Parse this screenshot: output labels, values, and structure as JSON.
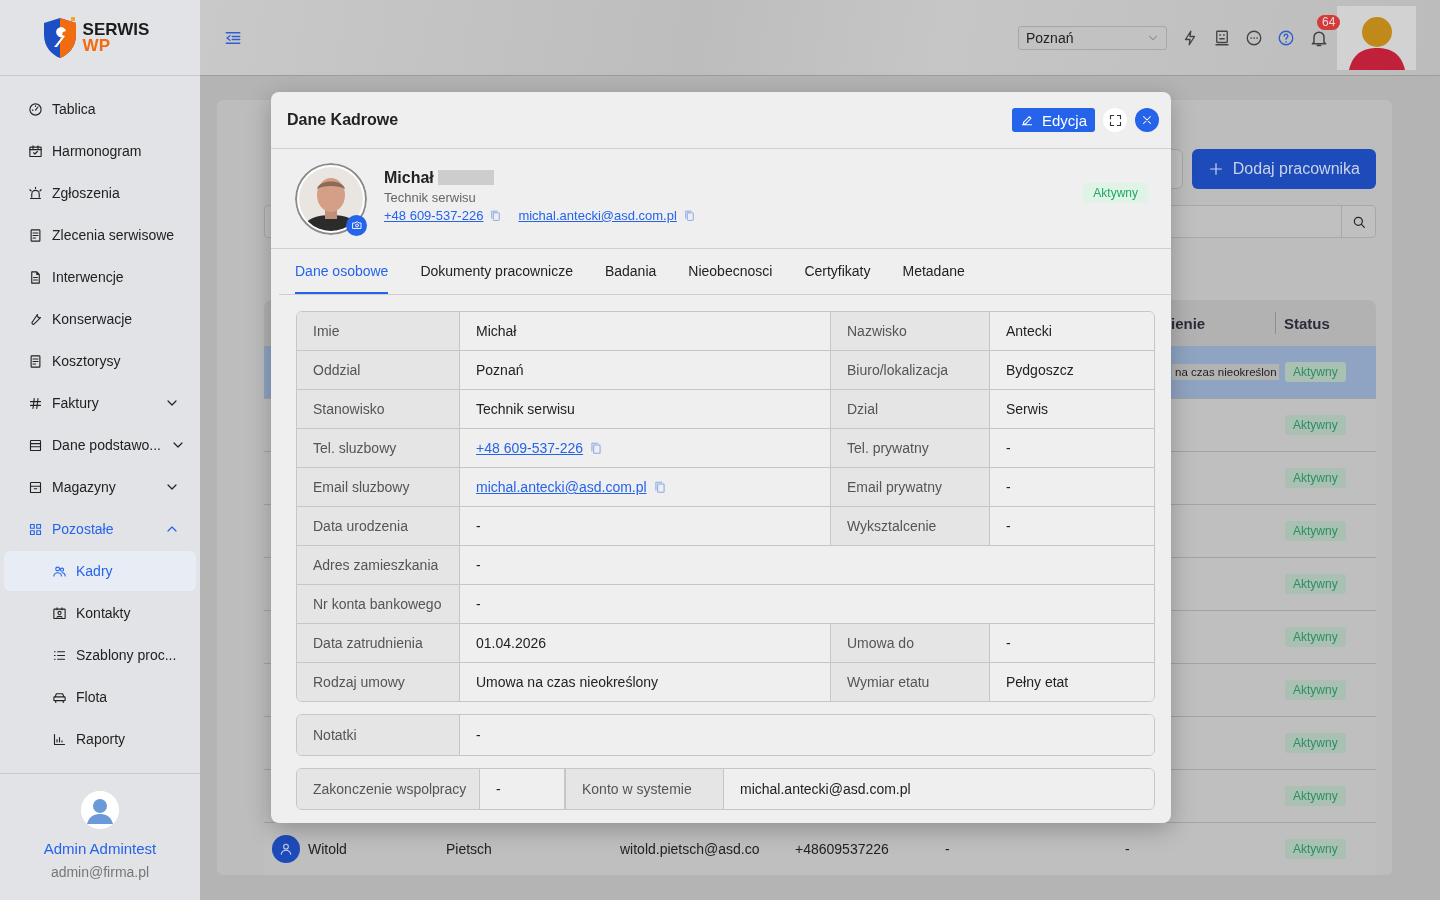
{
  "sidebar": {
    "logo": {
      "line_1": "SERWIS",
      "line_2": "WP"
    },
    "items": [
      {
        "label": "Tablica",
        "kind": "link",
        "selected": false
      },
      {
        "label": "Harmonogram",
        "kind": "link",
        "selected": false
      },
      {
        "label": "Zgłoszenia",
        "kind": "link",
        "selected": false
      },
      {
        "label": "Zlecenia serwisowe",
        "kind": "link",
        "selected": false
      },
      {
        "label": "Interwencje",
        "kind": "link",
        "selected": false
      },
      {
        "label": "Konserwacje",
        "kind": "link",
        "selected": false
      },
      {
        "label": "Kosztorysy",
        "kind": "link",
        "selected": false
      },
      {
        "label": "Faktury",
        "kind": "group",
        "expanded": false,
        "selected": false
      },
      {
        "label": "Dane podstawo...",
        "kind": "group",
        "expanded": false,
        "selected": false
      },
      {
        "label": "Magazyny",
        "kind": "group",
        "expanded": false,
        "selected": false
      },
      {
        "label": "Pozostałe",
        "kind": "group",
        "expanded": true,
        "selected": false,
        "children": [
          {
            "label": "Kadry",
            "selected": true
          },
          {
            "label": "Kontakty",
            "selected": false
          },
          {
            "label": "Szablony proc...",
            "selected": false
          },
          {
            "label": "Flota",
            "selected": false
          },
          {
            "label": "Raporty",
            "selected": false
          }
        ]
      }
    ],
    "user": {
      "name": "Admin Admintest",
      "email": "admin@firma.pl"
    }
  },
  "header": {
    "location_select": {
      "value": "Poznań"
    },
    "notifications": {
      "count": "64"
    }
  },
  "page": {
    "add_button": "Dodaj pracownika",
    "table": {
      "columns": [
        "ienie",
        "Status"
      ],
      "rows": [
        {
          "column_7": "na czas nieokreślon",
          "status": "Aktywny",
          "selected": true
        },
        {
          "status": "Aktywny",
          "selected": false
        },
        {
          "status": "Aktywny",
          "selected": false
        },
        {
          "status": "Aktywny",
          "selected": false
        },
        {
          "status": "Aktywny",
          "selected": false
        },
        {
          "status": "Aktywny",
          "selected": false
        },
        {
          "status": "Aktywny",
          "selected": false
        },
        {
          "status": "Aktywny",
          "selected": false
        },
        {
          "status": "Aktywny",
          "selected": false
        },
        {
          "first_name": "Witold",
          "last_name": "Pietsch",
          "email": "witold.pietsch@asd.co",
          "phone": "+48609537226",
          "column_5": "-",
          "column_6": "-",
          "status": "Aktywny",
          "selected": false
        }
      ]
    }
  },
  "modal": {
    "title": "Dane Kadrowe",
    "edit_button": "Edycja",
    "profile": {
      "first_name": "Michał",
      "position": "Technik serwisu",
      "phone": "+48 609-537-226",
      "email": "michal.antecki@asd.com.pl",
      "status": "Aktywny"
    },
    "tabs": [
      {
        "label": "Dane osobowe",
        "selected": true
      },
      {
        "label": "Dokumenty pracownicze",
        "selected": false
      },
      {
        "label": "Badania",
        "selected": false
      },
      {
        "label": "Nieobecnosci",
        "selected": false
      },
      {
        "label": "Certyfikaty",
        "selected": false
      },
      {
        "label": "Metadane",
        "selected": false
      }
    ],
    "details": [
      [
        {
          "label": "Imie",
          "value": "Michał"
        },
        {
          "label": "Nazwisko",
          "value": "Antecki"
        }
      ],
      [
        {
          "label": "Oddzial",
          "value": "Poznań"
        },
        {
          "label": "Biuro/lokalizacja",
          "value": "Bydgoszcz"
        }
      ],
      [
        {
          "label": "Stanowisko",
          "value": "Technik serwisu"
        },
        {
          "label": "Dzial",
          "value": "Serwis"
        }
      ],
      [
        {
          "label": "Tel. sluzbowy",
          "value": "+48 609-537-226",
          "kind": "link"
        },
        {
          "label": "Tel. prywatny",
          "value": "-"
        }
      ],
      [
        {
          "label": "Email sluzbowy",
          "value": "michal.antecki@asd.com.pl",
          "kind": "link"
        },
        {
          "label": "Email prywatny",
          "value": "-"
        }
      ],
      [
        {
          "label": "Data urodzenia",
          "value": "-"
        },
        {
          "label": "Wyksztalcenie",
          "value": "-"
        }
      ],
      [
        {
          "label": "Adres zamieszkania",
          "value": "-"
        }
      ],
      [
        {
          "label": "Nr konta bankowego",
          "value": "-"
        }
      ],
      [
        {
          "label": "Data zatrudnienia",
          "value": "01.04.2026"
        },
        {
          "label": "Umowa do",
          "value": "-"
        }
      ],
      [
        {
          "label": "Rodzaj umowy",
          "value": "Umowa na czas nieokreślony"
        },
        {
          "label": "Wymiar etatu",
          "value": "Pełny etat"
        }
      ]
    ],
    "notes": {
      "label": "Notatki",
      "value": "-"
    },
    "footer_fields": [
      {
        "label": "Zakonczenie wspolpracy",
        "value": "-"
      },
      {
        "label": "Konto w systemie",
        "value": "michal.antecki@asd.com.pl"
      }
    ]
  }
}
